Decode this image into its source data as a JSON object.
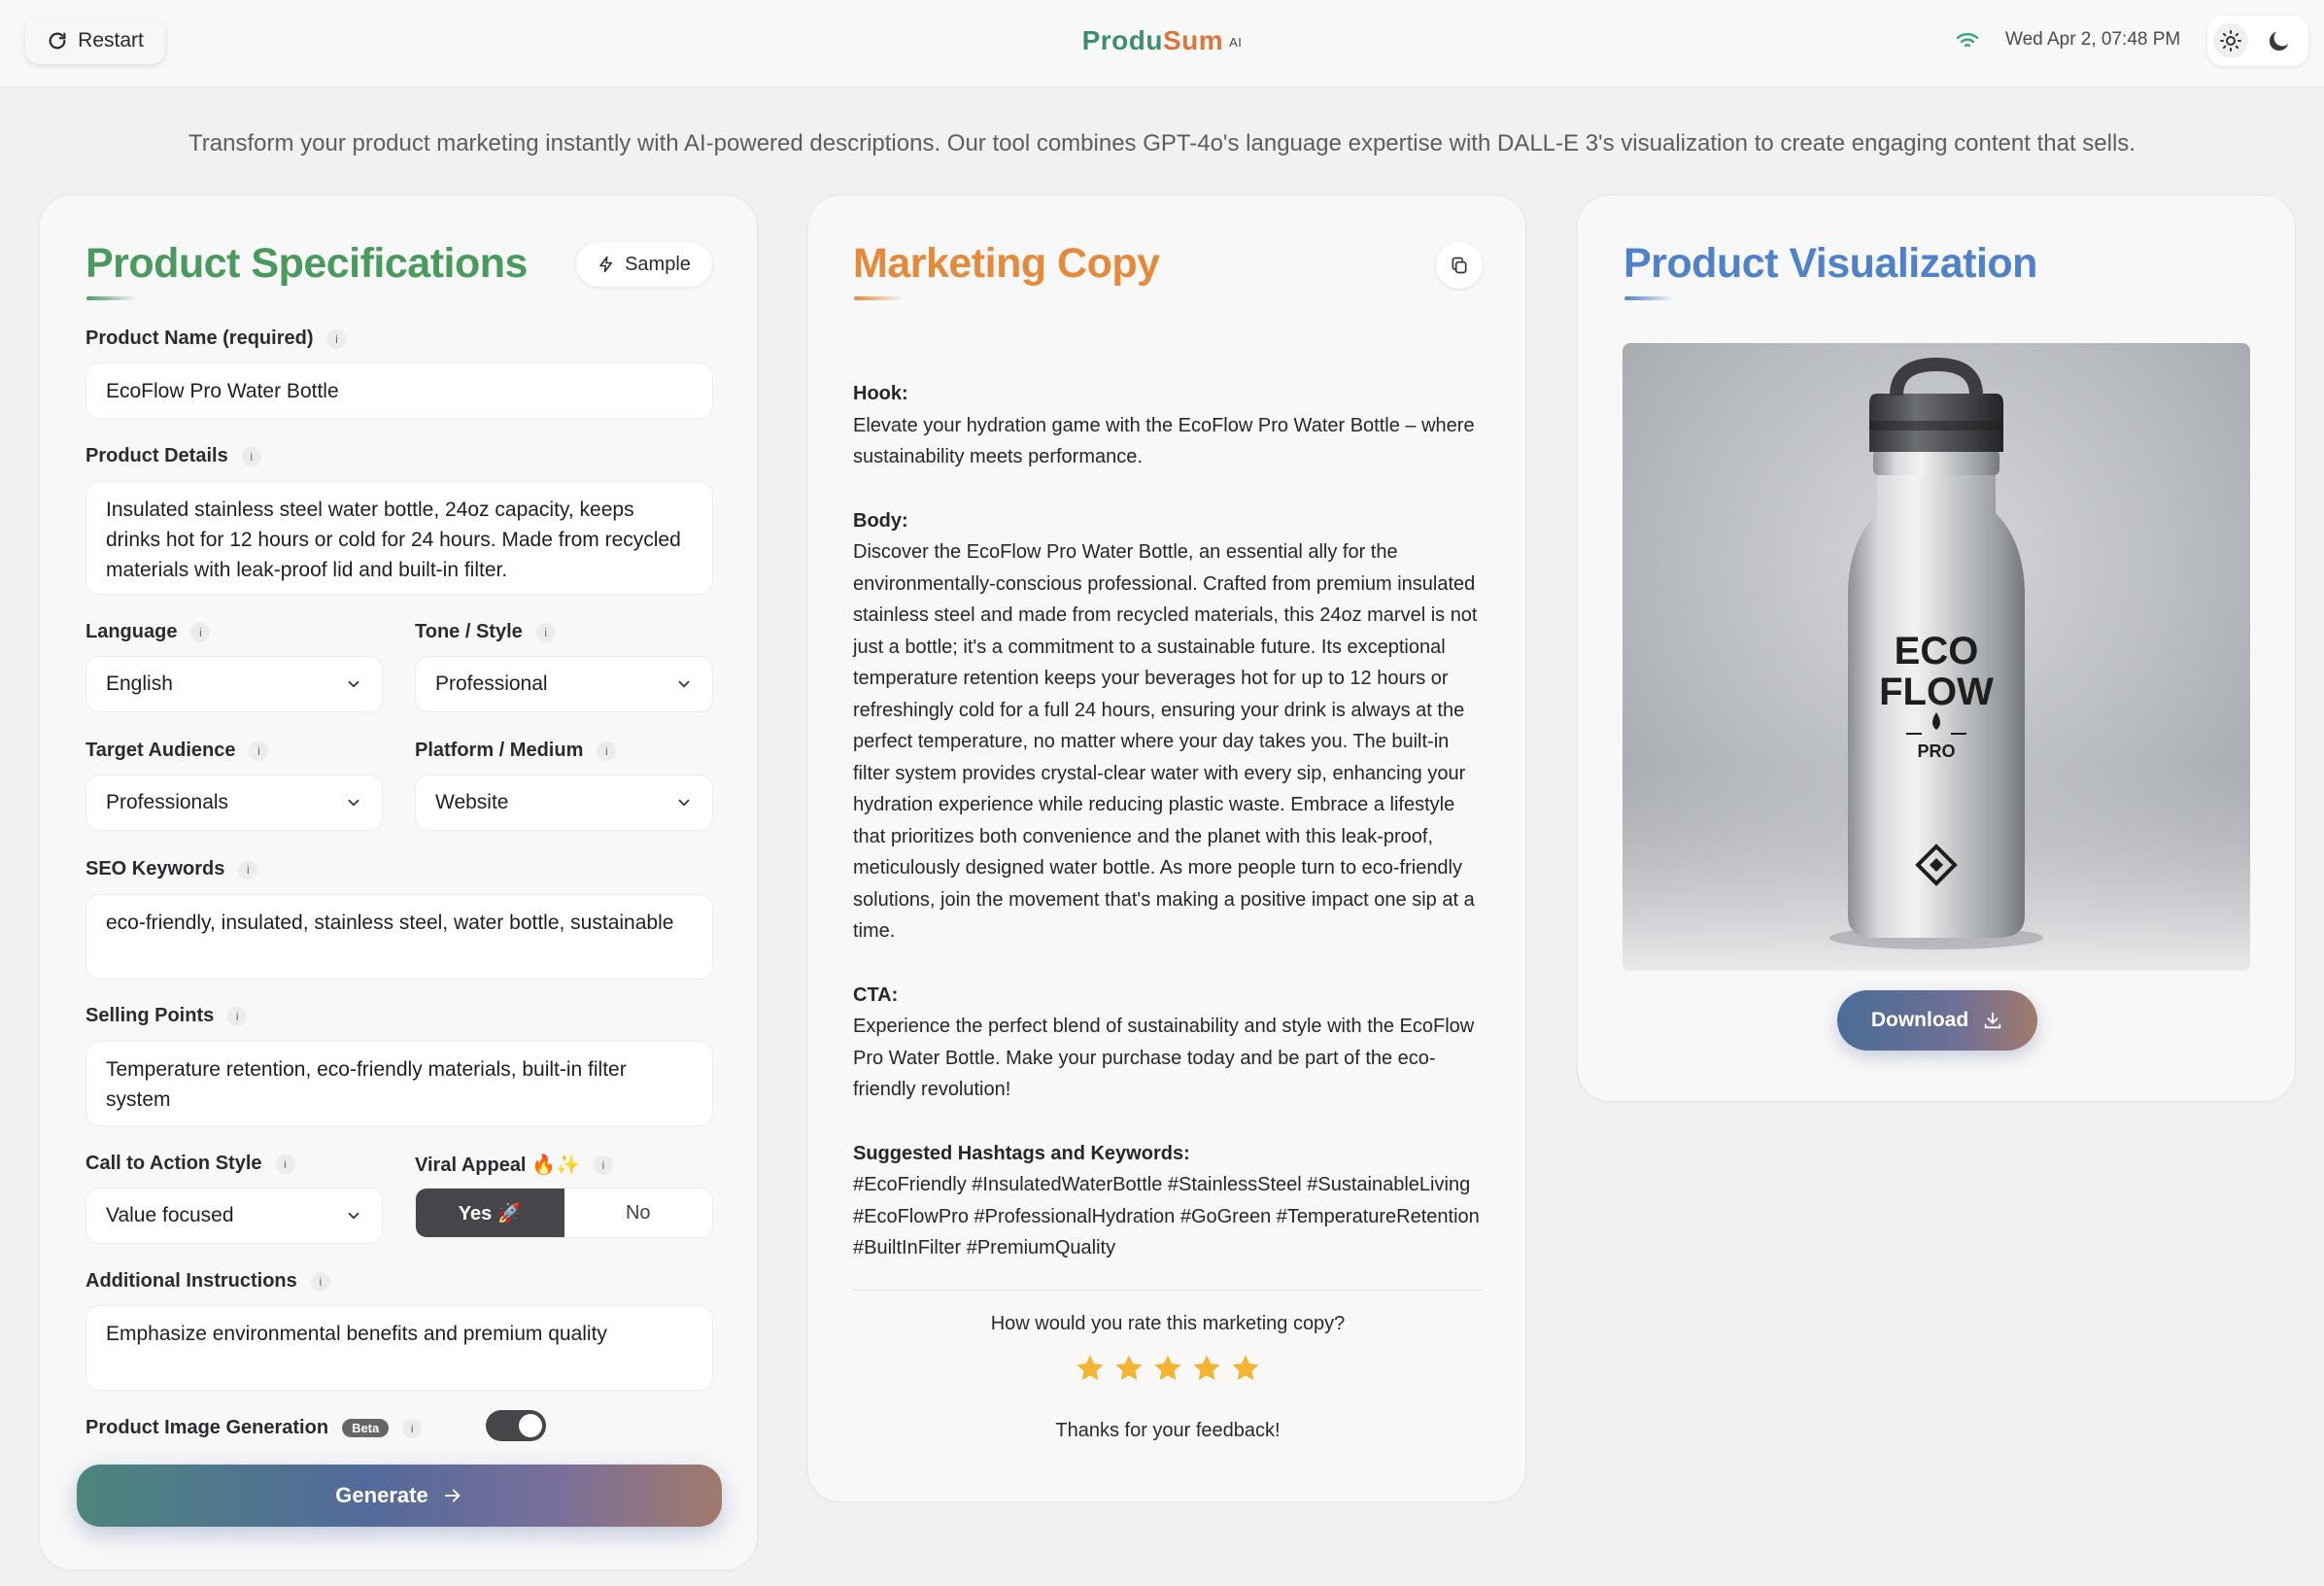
{
  "header": {
    "restart_label": "Restart",
    "brand_part1": "Produ",
    "brand_part2": "Sum",
    "brand_suffix": "AI",
    "datetime": "Wed Apr 2, 07:48 PM"
  },
  "tagline": "Transform your product marketing instantly with AI-powered descriptions. Our tool combines GPT-4o's language expertise with DALL-E 3's visualization to create engaging content that sells.",
  "specs": {
    "title": "Product Specifications",
    "sample_label": "Sample",
    "product_name_label": "Product Name (required)",
    "product_name_value": "EcoFlow Pro Water Bottle",
    "product_details_label": "Product Details",
    "product_details_value": "Insulated stainless steel water bottle, 24oz capacity, keeps drinks hot for 12 hours or cold for 24 hours. Made from recycled materials with leak-proof lid and built-in filter.",
    "language_label": "Language",
    "language_value": "English",
    "tone_label": "Tone / Style",
    "tone_value": "Professional",
    "audience_label": "Target Audience",
    "audience_value": "Professionals",
    "platform_label": "Platform / Medium",
    "platform_value": "Website",
    "seo_label": "SEO Keywords",
    "seo_value": "eco-friendly, insulated, stainless steel, water bottle, sustainable",
    "selling_label": "Selling Points",
    "selling_value": "Temperature retention, eco-friendly materials, built-in filter system",
    "cta_label": "Call to Action Style",
    "cta_value": "Value focused",
    "viral_label": "Viral Appeal 🔥✨",
    "viral_yes": "Yes 🚀",
    "viral_no": "No",
    "additional_label": "Additional Instructions",
    "additional_value": "Emphasize environmental benefits and premium quality",
    "image_gen_label": "Product Image Generation",
    "beta_label": "Beta",
    "image_gen_enabled": true,
    "generate_label": "Generate"
  },
  "copy": {
    "title": "Marketing Copy",
    "hook_heading": "Hook:",
    "hook_text": "Elevate your hydration game with the EcoFlow Pro Water Bottle – where sustainability meets performance.",
    "body_heading": "Body:",
    "body_text": "Discover the EcoFlow Pro Water Bottle, an essential ally for the environmentally-conscious professional. Crafted from premium insulated stainless steel and made from recycled materials, this 24oz marvel is not just a bottle; it's a commitment to a sustainable future. Its exceptional temperature retention keeps your beverages hot for up to 12 hours or refreshingly cold for a full 24 hours, ensuring your drink is always at the perfect temperature, no matter where your day takes you. The built-in filter system provides crystal-clear water with every sip, enhancing your hydration experience while reducing plastic waste. Embrace a lifestyle that prioritizes both convenience and the planet with this leak-proof, meticulously designed water bottle. As more people turn to eco-friendly solutions, join the movement that's making a positive impact one sip at a time.",
    "cta_heading": "CTA:",
    "cta_text": "Experience the perfect blend of sustainability and style with the EcoFlow Pro Water Bottle. Make your purchase today and be part of the eco-friendly revolution!",
    "hashtags_heading": "Suggested Hashtags and Keywords:",
    "hashtags_text": "#EcoFriendly #InsulatedWaterBottle #StainlessSteel #SustainableLiving #EcoFlowPro #ProfessionalHydration #GoGreen #TemperatureRetention #BuiltInFilter #PremiumQuality",
    "rating_question": "How would you rate this marketing copy?",
    "rating_value": 5,
    "rating_max": 5,
    "thanks_text": "Thanks for your feedback!"
  },
  "viz": {
    "title": "Product Visualization",
    "bottle_logo_line1": "ECO",
    "bottle_logo_line2": "FLOW",
    "bottle_logo_line3": "PRO",
    "download_label": "Download"
  },
  "colors": {
    "specs_title": "#4a9a5e",
    "copy_title": "#e58a3a",
    "viz_title": "#4f82c8",
    "star": "#f2b431",
    "brand_green": "#3f8f6d",
    "brand_orange": "#d8763c"
  }
}
